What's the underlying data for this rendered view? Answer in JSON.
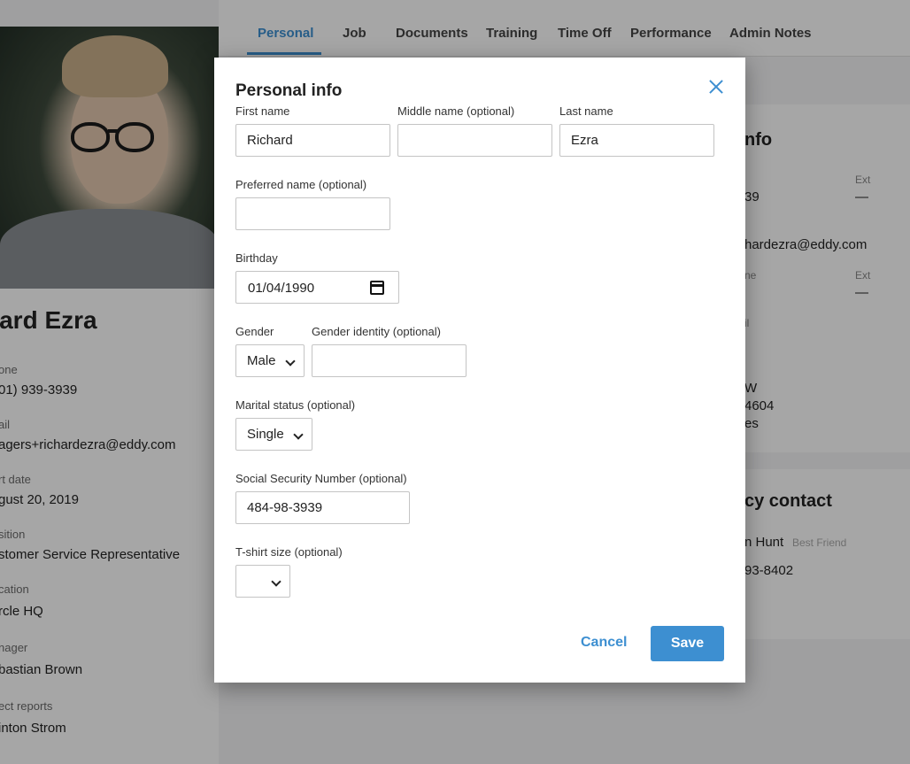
{
  "tabs": [
    {
      "label": "Personal"
    },
    {
      "label": "Job"
    },
    {
      "label": "Documents"
    },
    {
      "label": "Training"
    },
    {
      "label": "Time Off"
    },
    {
      "label": "Performance"
    },
    {
      "label": "Admin Notes"
    }
  ],
  "profile": {
    "name_partial": "hard Ezra",
    "fields": [
      {
        "label": "one",
        "value": "01) 939-3939"
      },
      {
        "label": "ail",
        "value": "agers+richardezra@eddy.com"
      },
      {
        "label": "rt date",
        "value": "gust 20, 2019"
      },
      {
        "label": "sition",
        "value": "stomer Service Representative"
      },
      {
        "label": "cation",
        "value": "rcle HQ"
      },
      {
        "label": "nager",
        "value": "bastian Brown"
      },
      {
        "label": "ect reports",
        "value": "inton Strom"
      }
    ]
  },
  "contact_card": {
    "title_partial": "nfo",
    "phone_partial": "39",
    "ext_label_1": "Ext",
    "ext_value_1": "—",
    "email_partial": "hardezra@eddy.com",
    "label_ne": "ne",
    "ext_label_2": "Ext",
    "ext_value_2": "—",
    "label_il": "il",
    "address_line1": "W",
    "address_line2": "4604",
    "address_line3": "es"
  },
  "emergency_card": {
    "title_partial": "cy contact",
    "contact_name_partial": "n Hunt",
    "relationship": "Best Friend",
    "phone_partial": "93-8402"
  },
  "modal": {
    "title": "Personal info",
    "first_name": {
      "label": "First name",
      "value": "Richard"
    },
    "middle_name": {
      "label": "Middle name (optional)",
      "value": ""
    },
    "last_name": {
      "label": "Last name",
      "value": "Ezra"
    },
    "preferred_name": {
      "label": "Preferred name (optional)",
      "value": ""
    },
    "birthday": {
      "label": "Birthday",
      "value": "01/04/1990"
    },
    "gender": {
      "label": "Gender",
      "value": "Male"
    },
    "gender_identity": {
      "label": "Gender identity (optional)",
      "value": ""
    },
    "marital_status": {
      "label": "Marital status (optional)",
      "value": "Single"
    },
    "ssn": {
      "label": "Social Security Number (optional)",
      "value": "484-98-3939"
    },
    "tshirt_size": {
      "label": "T-shirt size (optional)",
      "value": ""
    },
    "cancel_label": "Cancel",
    "save_label": "Save"
  },
  "colors": {
    "accent": "#3d8fd1",
    "overlay": "rgba(0,0,0,0.35)"
  }
}
